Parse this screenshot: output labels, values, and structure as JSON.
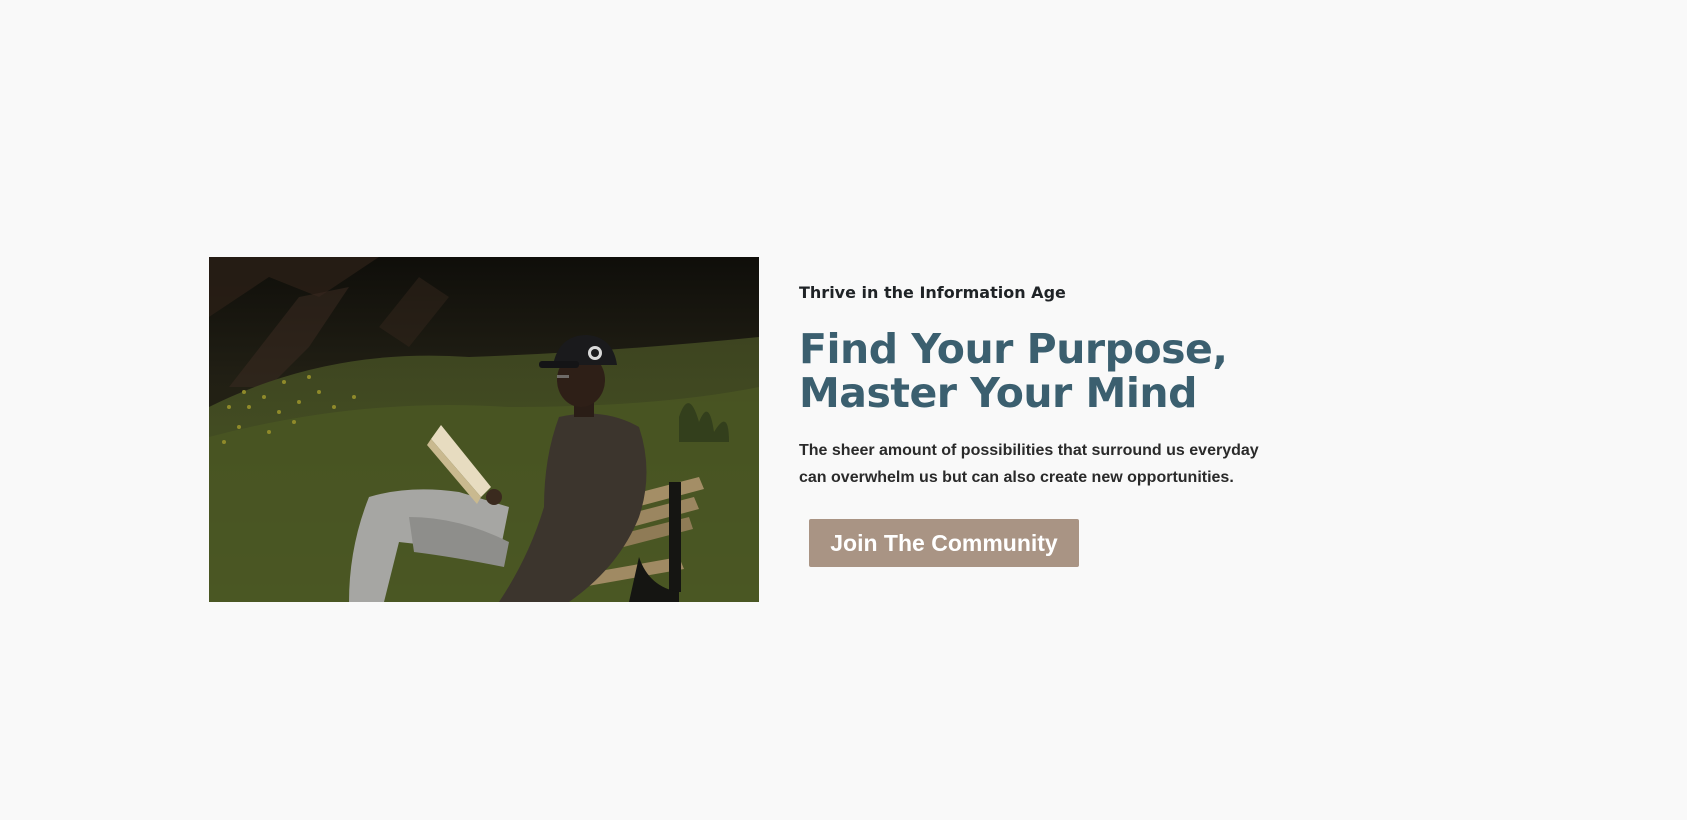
{
  "hero": {
    "image_alt": "Man in a cap reading a book on a wooden bench in a grassy field",
    "eyebrow": "Thrive in the Information Age",
    "headline_line1": "Find Your Purpose,",
    "headline_line2": "Master Your Mind",
    "description": "The sheer amount of possibilities that surround us everyday can overwhelm us but can also create new opportunities.",
    "cta_label": "Join The Community"
  },
  "colors": {
    "page_background": "#f9f9f9",
    "headline": "#3b5f6f",
    "body_text": "#2a2a2a",
    "button_background": "#a99484",
    "button_text": "#ffffff"
  }
}
